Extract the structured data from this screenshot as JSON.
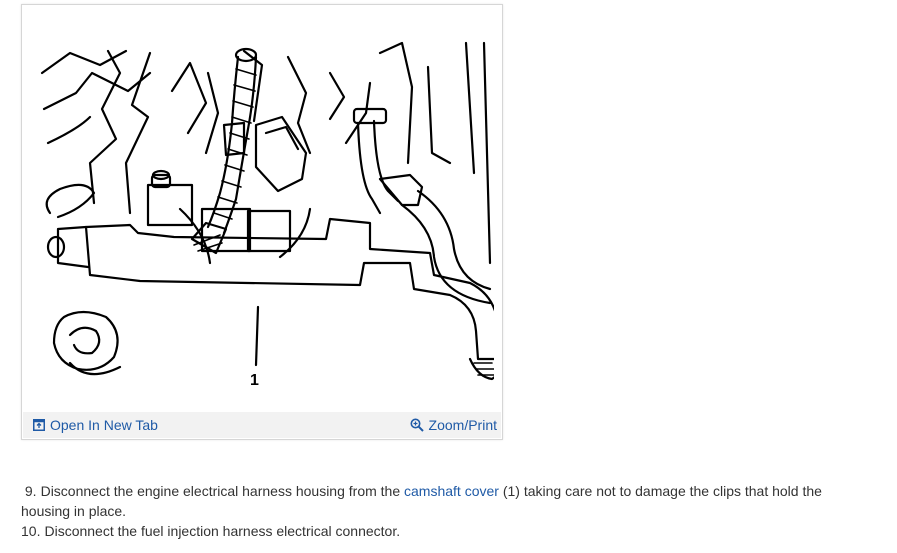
{
  "figure": {
    "callout_label": "1",
    "toolbar": {
      "open_tab_label": "Open In New Tab",
      "zoom_print_label": "Zoom/Print",
      "open_tab_icon": "open-in-new-tab-icon",
      "zoom_icon": "magnifier-icon"
    }
  },
  "steps": [
    {
      "number": "9.",
      "text_before": "Disconnect the engine electrical harness housing from the",
      "link_text": "camshaft cover",
      "text_after": "(1) taking care not to damage the clips that hold the housing in place."
    },
    {
      "number": "10.",
      "text": "Disconnect the fuel injection harness electrical connector."
    }
  ],
  "colors": {
    "link": "#1f5aa6",
    "toolbar_bg": "#f2f2f2",
    "card_border": "#d6d6d6",
    "body_text": "#333333"
  }
}
